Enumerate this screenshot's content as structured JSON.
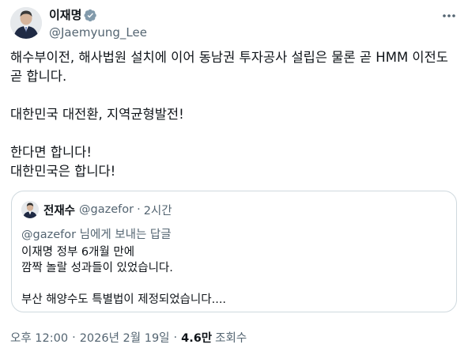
{
  "author": {
    "name": "이재명",
    "handle": "@Jaemyung_Lee",
    "verified_color": "#829aab"
  },
  "tweet": {
    "lines": [
      "해수부이전, 해사법원 설치에 이어 동남권 투자공사 설립은 물론 곧  HMM 이전도",
      "곧 합니다.",
      "",
      "대한민국 대전환, 지역균형발전!",
      "",
      "한다면 합니다!",
      "대한민국은 합니다!"
    ]
  },
  "quote": {
    "name": "전재수",
    "handle": "@gazefor",
    "dot": "·",
    "time": "2시간",
    "reply_mention": "@gazefor",
    "reply_suffix": " 님에게 보내는 답글",
    "body_line1": "이재명 정부 6개월 만에",
    "body_line2": "깜짝 놀랄 성과들이 있었습니다.",
    "body_line3": "부산 해양수도 특별법이 제정되었습니다...."
  },
  "meta": {
    "time": "오후 12:00",
    "sep": "·",
    "date": "2026년 2월 19일",
    "views_count": "4.6만",
    "views_label": "조회수"
  },
  "colors": {
    "text": "#0f1419",
    "secondary": "#536471",
    "border": "#cfd9de"
  },
  "icons": {
    "verified": "verified-badge-icon",
    "more": "more-options-icon"
  }
}
